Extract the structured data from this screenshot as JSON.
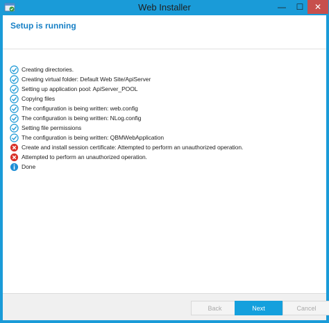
{
  "window": {
    "title": "Web Installer",
    "minimize_glyph": "—",
    "maximize_glyph": "☐",
    "close_glyph": "✕",
    "accent_color": "#1a9bd8"
  },
  "header": {
    "title": "Setup is running",
    "title_color": "#1780c6"
  },
  "log": {
    "items": [
      {
        "status": "success",
        "icon": "check-circle-icon",
        "text": "Creating directories."
      },
      {
        "status": "success",
        "icon": "check-circle-icon",
        "text": "Creating virtual folder: Default Web Site/ApiServer"
      },
      {
        "status": "success",
        "icon": "check-circle-icon",
        "text": "Setting up application pool: ApiServer_POOL"
      },
      {
        "status": "success",
        "icon": "check-circle-icon",
        "text": "Copying files"
      },
      {
        "status": "success",
        "icon": "check-circle-icon",
        "text": "The configuration is being written: web.config"
      },
      {
        "status": "success",
        "icon": "check-circle-icon",
        "text": "The configuration is being written: NLog.config"
      },
      {
        "status": "success",
        "icon": "check-circle-icon",
        "text": "Setting file permissions"
      },
      {
        "status": "success",
        "icon": "check-circle-icon",
        "text": "The configuration is being written: QBMWebApplication"
      },
      {
        "status": "error",
        "icon": "error-circle-icon",
        "text": "Create and install session certificate: Attempted to perform an unauthorized operation."
      },
      {
        "status": "error",
        "icon": "error-circle-icon",
        "text": "Attempted to perform an unauthorized operation."
      },
      {
        "status": "info",
        "icon": "info-circle-icon",
        "text": "Done"
      }
    ],
    "status_colors": {
      "success": "#2a9fd8",
      "error": "#d9332b",
      "info": "#1f8fd6"
    }
  },
  "footer": {
    "back_label": "Back",
    "next_label": "Next",
    "cancel_label": "Cancel"
  }
}
